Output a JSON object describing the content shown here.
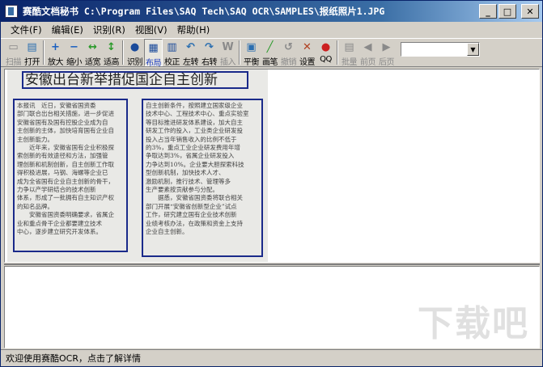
{
  "window": {
    "title": "赛酷文档秘书 C:\\Program Files\\SAQ Tech\\SAQ OCR\\SAMPLES\\报纸照片1.JPG",
    "controls": {
      "minimize": "_",
      "maximize": "□",
      "close": "✕"
    }
  },
  "menu": [
    {
      "id": "file",
      "label": "文件(F)"
    },
    {
      "id": "edit",
      "label": "编辑(E)"
    },
    {
      "id": "recognize",
      "label": "识别(R)"
    },
    {
      "id": "view",
      "label": "视图(V)"
    },
    {
      "id": "help",
      "label": "帮助(H)"
    }
  ],
  "toolbar": [
    {
      "id": "scan",
      "label": "扫描",
      "icon": "▭",
      "color": "#8a8a8a",
      "disabled": true,
      "icon_name": "scanner-icon"
    },
    {
      "id": "open",
      "label": "打开",
      "icon": "▤",
      "color": "#2c6fb0",
      "disabled": false,
      "icon_name": "open-folder-icon"
    },
    {
      "sep": true
    },
    {
      "id": "zoom-in",
      "label": "放大",
      "icon": "+",
      "color": "#1a5fc0",
      "disabled": false,
      "icon_name": "zoom-in-icon"
    },
    {
      "id": "zoom-out",
      "label": "缩小",
      "icon": "−",
      "color": "#1a5fc0",
      "disabled": false,
      "icon_name": "zoom-out-icon"
    },
    {
      "id": "fit-width",
      "label": "适宽",
      "icon": "↔",
      "color": "#2a9a2a",
      "disabled": false,
      "icon_name": "fit-width-icon"
    },
    {
      "id": "fit-height",
      "label": "适高",
      "icon": "↕",
      "color": "#2a9a2a",
      "disabled": false,
      "icon_name": "fit-height-icon"
    },
    {
      "sep": true
    },
    {
      "id": "recognize",
      "label": "识别",
      "icon": "●",
      "color": "#1a4a9a",
      "disabled": false,
      "icon_name": "recognize-icon"
    },
    {
      "id": "layout",
      "label": "布局",
      "icon": "▦",
      "color": "#1a4a9a",
      "disabled": false,
      "active": true,
      "icon_name": "layout-icon"
    },
    {
      "id": "proofread",
      "label": "校正",
      "icon": "▥",
      "color": "#1a4a9a",
      "disabled": false,
      "icon_name": "proofread-icon"
    },
    {
      "id": "rotate-left",
      "label": "左转",
      "icon": "↶",
      "color": "#2c6fb0",
      "disabled": false,
      "icon_name": "rotate-left-icon"
    },
    {
      "id": "rotate-right",
      "label": "右转",
      "icon": "↷",
      "color": "#2c6fb0",
      "disabled": false,
      "icon_name": "rotate-right-icon"
    },
    {
      "id": "insert",
      "label": "插入",
      "icon": "W",
      "color": "#8a8a8a",
      "disabled": true,
      "icon_name": "word-insert-icon"
    },
    {
      "sep": true
    },
    {
      "id": "balance",
      "label": "平衡",
      "icon": "▣",
      "color": "#2c6fb0",
      "disabled": false,
      "icon_name": "balance-icon"
    },
    {
      "id": "brush",
      "label": "画笔",
      "icon": "╱",
      "color": "#2a9a2a",
      "disabled": false,
      "icon_name": "brush-icon"
    },
    {
      "id": "undo",
      "label": "撤销",
      "icon": "↺",
      "color": "#8a8a8a",
      "disabled": true,
      "icon_name": "undo-icon"
    },
    {
      "id": "settings",
      "label": "设置",
      "icon": "✕",
      "color": "#b04020",
      "disabled": false,
      "icon_name": "tools-icon"
    },
    {
      "id": "qq",
      "label": "QQ",
      "icon": "●",
      "color": "#cc2020",
      "disabled": false,
      "icon_name": "qq-penguin-icon"
    },
    {
      "sep": true
    },
    {
      "id": "batch",
      "label": "批量",
      "icon": "▤",
      "color": "#8a8a8a",
      "disabled": true,
      "icon_name": "batch-icon"
    },
    {
      "id": "prev-page",
      "label": "前页",
      "icon": "◀",
      "color": "#8a8a8a",
      "disabled": true,
      "icon_name": "prev-page-icon"
    },
    {
      "id": "next-page",
      "label": "后页",
      "icon": "▶",
      "color": "#8a8a8a",
      "disabled": true,
      "icon_name": "next-page-icon"
    }
  ],
  "page_select": {
    "value": ""
  },
  "scan": {
    "headline": "安徽出台新举措促国企自主创新",
    "column1": [
      "本报讯　近日，安徽省国资委",
      "部门联合出台相关措施，进一步促进",
      "安徽省国有及国有控股企业成为自",
      "主创新的主体，加快培育国有企业自",
      "主创新能力。",
      "　　近年来，安徽省国有企业积极探",
      "索创新的有效途径和方法，加强管",
      "理创新和机制创新，自主创新工作取",
      "得积极进展，马钢、海螺等企业已",
      "成为全省国有企业自主创新的骨干，",
      "力争以产学研结合的技术创新",
      "体系，形成了一批拥有自主知识产权",
      "的知名品牌。",
      "　　安徽省国资委明确要求，省属企",
      "业和重点骨干企业都要建立技术",
      "中心，逐步建立研究开发体系。"
    ],
    "column2": [
      "自主创新条件，按照建立国家级企业",
      "技术中心、工程技术中心、重点实验室",
      "等目标推进研发体系建设，加大自主",
      "研发工作的投入，工业类企业研发投",
      "投入占当年销售收入的比例不低于",
      "的3%，重点工业企业研发费用年增",
      "争取达到3%，省属企业研发投入",
      "力争达到10%。企业要大胆探索科技",
      "型创新机制，加快技术人才、",
      "激励机制，推行技术、管理等多",
      "生产要素按贡献参与分配。",
      "",
      "　　据悉，安徽省国资委将联合相关",
      "部门开展“安徽省创新型企业”试点",
      "工作，研究建立国有企业技术创新",
      "业绩考核办法，在政策和资金上支持",
      "企业自主创新。"
    ]
  },
  "watermark": "下载吧",
  "status": {
    "text": "欢迎使用赛酷OCR，点击了解详情"
  }
}
